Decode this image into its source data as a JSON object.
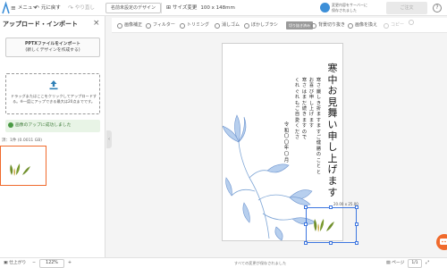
{
  "topbar": {
    "menu": "メニュー",
    "undo": "元に戻す",
    "redo": "やり直し",
    "design_button": "名前未設定のデザイン",
    "size_label": "サイズ変更",
    "size_value": "100 x 148mm",
    "save_status_line1": "変更内容をサーバーに",
    "save_status_line2": "保存されました",
    "order_button": "ご注文",
    "help": "?"
  },
  "left_panel": {
    "title": "アップロード・インポート",
    "close": "×",
    "import_button_line1": "PPTXファイルをインポート",
    "import_button_line2": "(新しくデザインを作成する)",
    "drop_text_line1": "ドラッグまたはここをクリックしてアップロードす",
    "drop_text_line2": "る。※一度にアップできる最大は20点までです。",
    "success_message": "画像のアップに成功しました",
    "upload_count": "済：1件 (0.0011 GB)"
  },
  "toolbar": {
    "items": [
      {
        "label": "画像補正",
        "enabled": true
      },
      {
        "label": "フィルター",
        "enabled": true
      },
      {
        "label": "トリミング",
        "enabled": true
      },
      {
        "label": "消しゴム",
        "enabled": true
      },
      {
        "label": "ぼかしブラシ",
        "enabled": true
      },
      {
        "label": "背景切り抜き",
        "enabled": true
      },
      {
        "label": "画像を換え",
        "enabled": true
      },
      {
        "label": "コピー",
        "enabled": false
      }
    ],
    "disabled_badge": "切り抜き済み"
  },
  "card": {
    "title": "寒中お見舞い申し上げます",
    "columns": [
      "寒さ厳しき折ますますご健勝のことと",
      "お喜び申し上げます",
      "寒さはまだ続きますので",
      "くれぐれもご自愛くださ"
    ],
    "date": "令和〇〇年〇月"
  },
  "selection": {
    "size_label": "20.00 x 25.00"
  },
  "bottombar": {
    "home": "仕上がり",
    "zoom": "122%",
    "status": "すべての変更が保存されました",
    "page_label": "ページ",
    "page_value": "1/1"
  },
  "colors": {
    "accent_orange": "#f06a2c",
    "selection_blue": "#3d76e0",
    "success_green": "#3d7a38",
    "flower_blue": "#7fa6d6",
    "leaf_green": "#6f8f2a"
  }
}
